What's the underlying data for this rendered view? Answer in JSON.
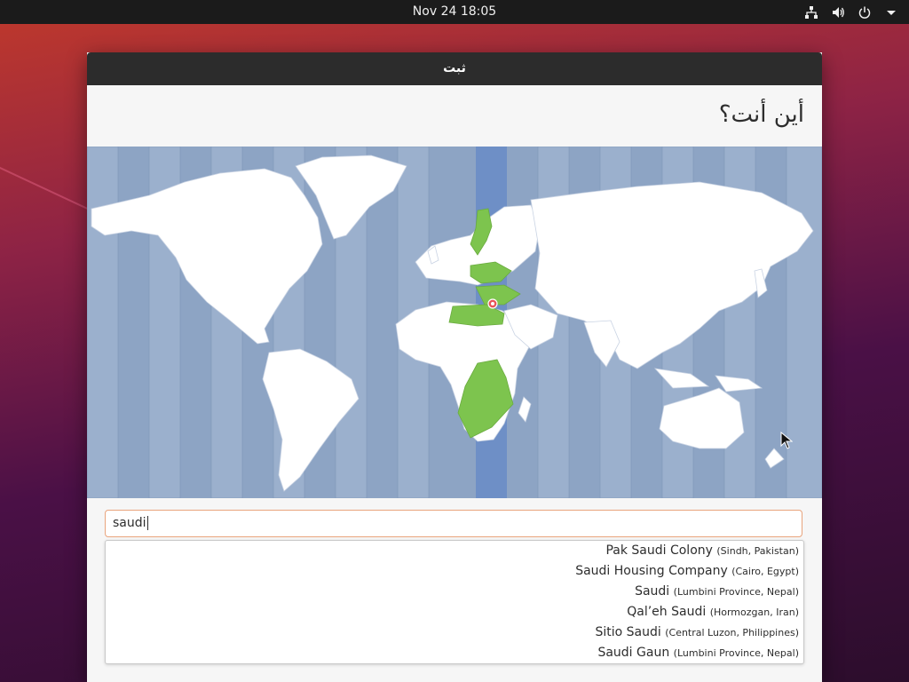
{
  "topbar": {
    "clock": "Nov 24  18:05",
    "icons": [
      "network-icon",
      "volume-icon",
      "power-icon",
      "menu-arrow-icon"
    ]
  },
  "window": {
    "title": "ثبت",
    "heading": "أين أنت؟"
  },
  "map": {
    "highlight_color": "#7dc44e",
    "zone_band_color": "#6e8fc6",
    "ocean_color": "#8da4c4",
    "land_color": "#ffffff",
    "marker_color": "#e8555a"
  },
  "search": {
    "value": "saudi"
  },
  "suggestions": [
    {
      "name": "Pak Saudi Colony",
      "region": "(Sindh, Pakistan)"
    },
    {
      "name": "Saudi Housing Company",
      "region": "(Cairo, Egypt)"
    },
    {
      "name": "Saudi",
      "region": "(Lumbini Province, Nepal)"
    },
    {
      "name": "Qal’eh Saudi",
      "region": "(Hormozgan, Iran)"
    },
    {
      "name": "Sitio Saudi",
      "region": "(Central Luzon, Philippines)"
    },
    {
      "name": "Saudi Gaun",
      "region": "(Lumbini Province, Nepal)"
    }
  ]
}
